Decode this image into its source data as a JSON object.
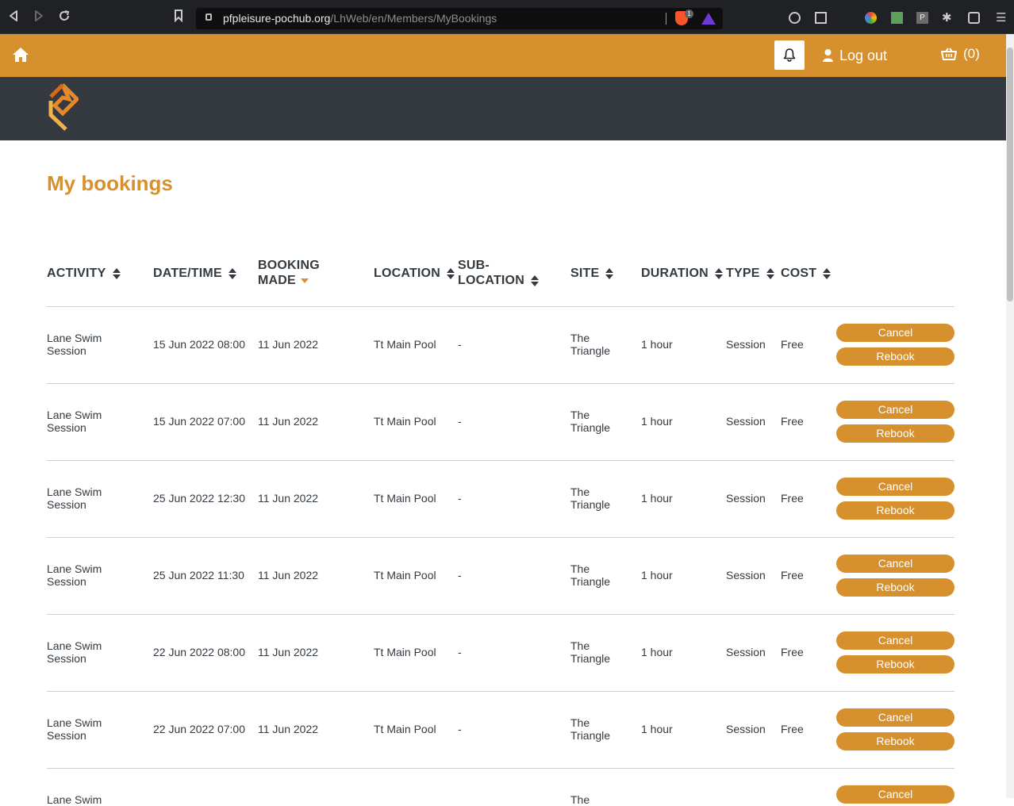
{
  "browser": {
    "url_host": "pfpleisure-pochub.org",
    "url_path": "/LhWeb/en/Members/MyBookings",
    "shield_count": "1"
  },
  "header": {
    "logout_label": "Log out",
    "basket_count": "(0)"
  },
  "page": {
    "title": "My bookings"
  },
  "table": {
    "headers": {
      "activity": "ACTIVITY",
      "datetime": "DATE/TIME",
      "booking_made_1": "BOOKING",
      "booking_made_2": "MADE",
      "location": "LOCATION",
      "sublocation_1": "SUB-",
      "sublocation_2": "LOCATION",
      "site": "SITE",
      "duration": "DURATION",
      "type": "TYPE",
      "cost": "COST"
    },
    "rows": [
      {
        "activity_1": "Lane Swim",
        "activity_2": "Session",
        "datetime": "15 Jun 2022 08:00",
        "booked": "11 Jun 2022",
        "location": "Tt Main Pool",
        "sublocation": "-",
        "site_1": "The",
        "site_2": "Triangle",
        "duration": "1 hour",
        "type": "Session",
        "cost": "Free",
        "cancel": "Cancel",
        "rebook": "Rebook"
      },
      {
        "activity_1": "Lane Swim",
        "activity_2": "Session",
        "datetime": "15 Jun 2022 07:00",
        "booked": "11 Jun 2022",
        "location": "Tt Main Pool",
        "sublocation": "-",
        "site_1": "The",
        "site_2": "Triangle",
        "duration": "1 hour",
        "type": "Session",
        "cost": "Free",
        "cancel": "Cancel",
        "rebook": "Rebook"
      },
      {
        "activity_1": "Lane Swim",
        "activity_2": "Session",
        "datetime": "25 Jun 2022 12:30",
        "booked": "11 Jun 2022",
        "location": "Tt Main Pool",
        "sublocation": "-",
        "site_1": "The",
        "site_2": "Triangle",
        "duration": "1 hour",
        "type": "Session",
        "cost": "Free",
        "cancel": "Cancel",
        "rebook": "Rebook"
      },
      {
        "activity_1": "Lane Swim",
        "activity_2": "Session",
        "datetime": "25 Jun 2022 11:30",
        "booked": "11 Jun 2022",
        "location": "Tt Main Pool",
        "sublocation": "-",
        "site_1": "The",
        "site_2": "Triangle",
        "duration": "1 hour",
        "type": "Session",
        "cost": "Free",
        "cancel": "Cancel",
        "rebook": "Rebook"
      },
      {
        "activity_1": "Lane Swim",
        "activity_2": "Session",
        "datetime": "22 Jun 2022 08:00",
        "booked": "11 Jun 2022",
        "location": "Tt Main Pool",
        "sublocation": "-",
        "site_1": "The",
        "site_2": "Triangle",
        "duration": "1 hour",
        "type": "Session",
        "cost": "Free",
        "cancel": "Cancel",
        "rebook": "Rebook"
      },
      {
        "activity_1": "Lane Swim",
        "activity_2": "Session",
        "datetime": "22 Jun 2022 07:00",
        "booked": "11 Jun 2022",
        "location": "Tt Main Pool",
        "sublocation": "-",
        "site_1": "The",
        "site_2": "Triangle",
        "duration": "1 hour",
        "type": "Session",
        "cost": "Free",
        "cancel": "Cancel",
        "rebook": "Rebook"
      },
      {
        "activity_1": "Lane Swim",
        "site_1": "The",
        "cancel": "Cancel"
      }
    ]
  },
  "colors": {
    "accent": "#d6902e",
    "brand_dark": "#343a40",
    "text": "#333a40"
  }
}
